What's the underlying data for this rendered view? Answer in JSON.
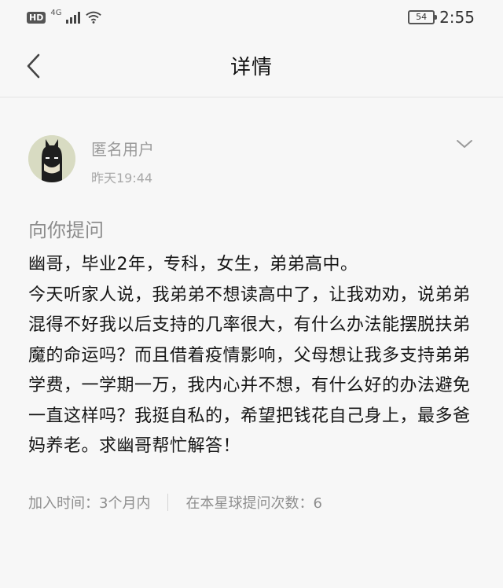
{
  "status_bar": {
    "hd": "HD",
    "network": "4G",
    "battery": "54",
    "time": "2:55"
  },
  "nav": {
    "back_icon": "chevron-left-icon",
    "title": "详情"
  },
  "post": {
    "author": "匿名用户",
    "time": "昨天19:44",
    "expand_icon": "chevron-down-icon",
    "label": "向你提问",
    "body": "幽哥，毕业2年，专科，女生，弟弟高中。\n今天听家人说，我弟弟不想读高中了，让我劝劝，说弟弟混得不好我以后支持的几率很大，有什么办法能摆脱扶弟魔的命运吗？而且借着疫情影响，父母想让我多支持弟弟学费，一学期一万，我内心并不想，有什么好的办法避免一直这样吗？我挺自私的，希望把钱花自己身上，最多爸妈养老。求幽哥帮忙解答！"
  },
  "meta": {
    "join_time": "加入时间：3个月内",
    "ask_count": "在本星球提问次数：6"
  }
}
